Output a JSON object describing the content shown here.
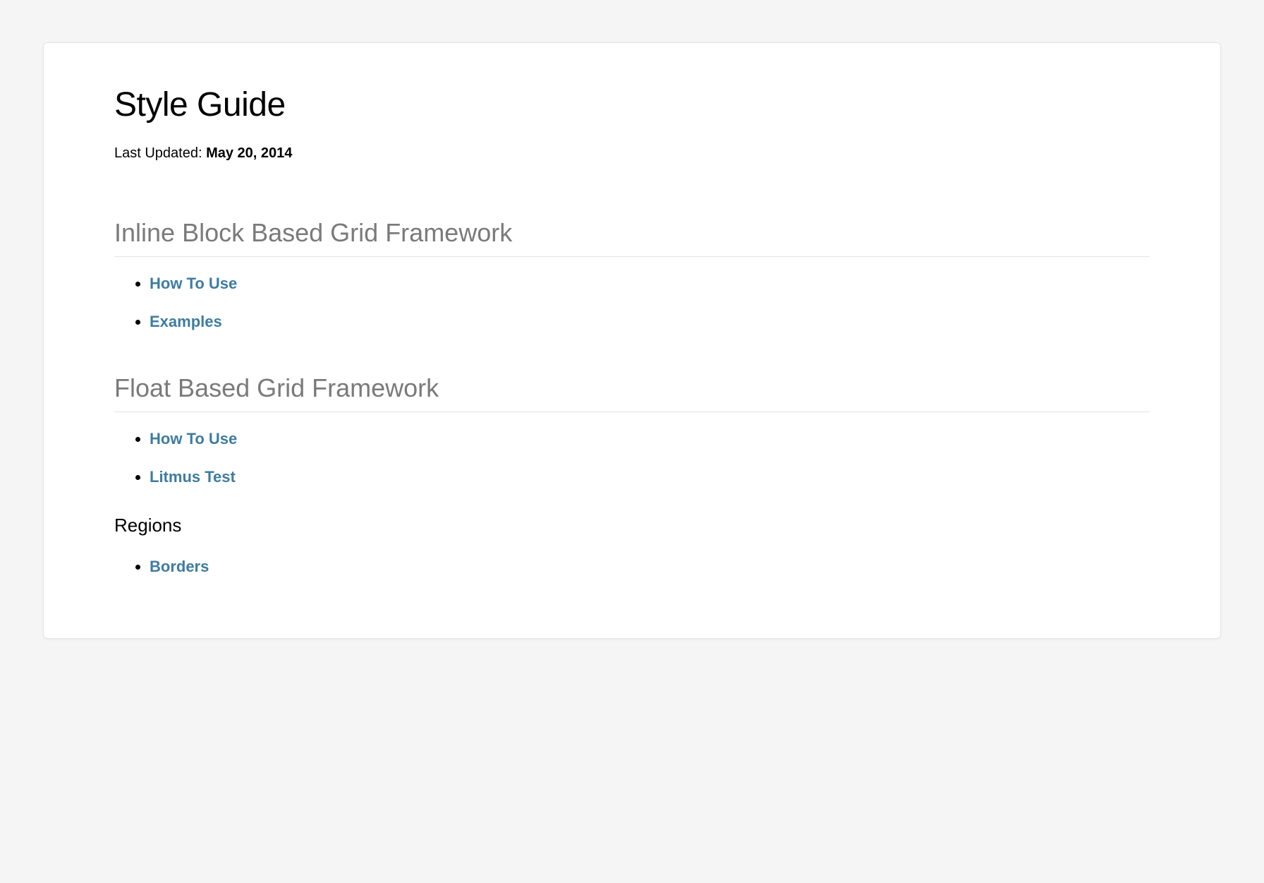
{
  "header": {
    "title": "Style Guide",
    "last_updated_label": "Last Updated: ",
    "last_updated_date": "May 20, 2014"
  },
  "sections": {
    "inline_block": {
      "heading": "Inline Block Based Grid Framework",
      "links": {
        "how_to_use": "How To Use",
        "examples": "Examples"
      }
    },
    "float_based": {
      "heading": "Float Based Grid Framework",
      "links": {
        "how_to_use": "How To Use",
        "litmus_test": "Litmus Test"
      },
      "subsection": {
        "heading": "Regions",
        "links": {
          "borders": "Borders"
        }
      }
    }
  }
}
